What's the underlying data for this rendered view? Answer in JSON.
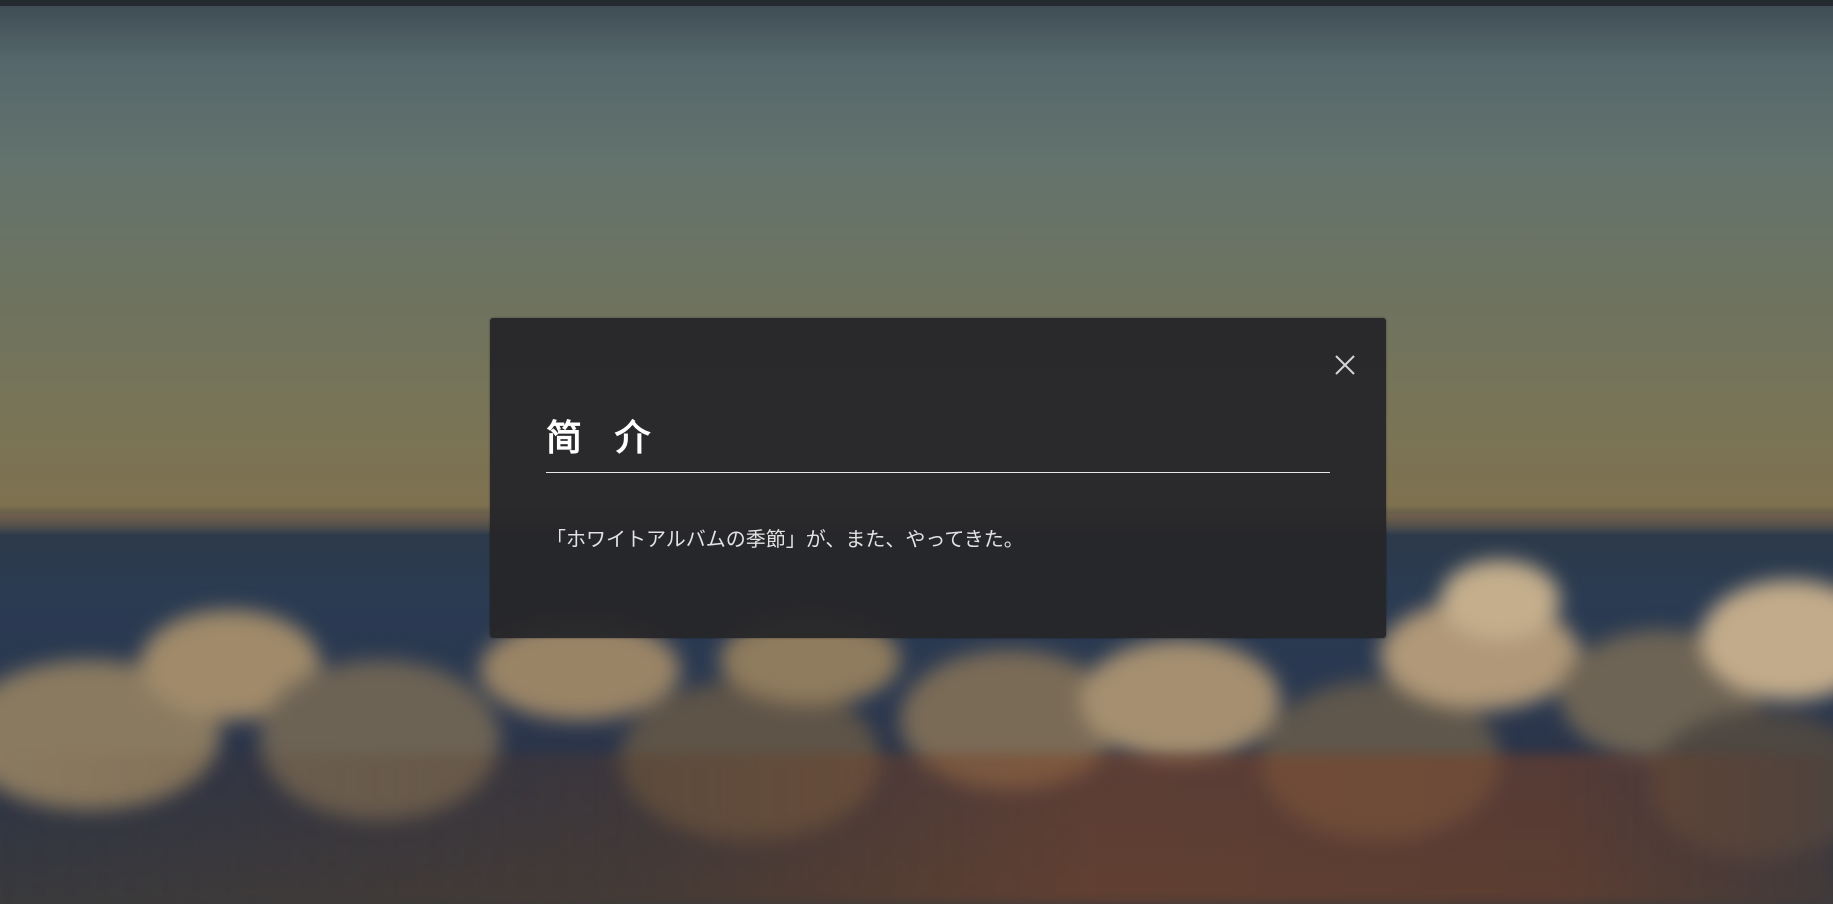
{
  "modal": {
    "title": "简 介",
    "body": "「ホワイトアルバムの季節」が、また、やってきた。",
    "close_icon": "close-icon"
  },
  "colors": {
    "modal_background": "#26272a",
    "title_text": "#ffffff",
    "body_text": "#e2e2e2",
    "divider": "#e6e6e6"
  }
}
